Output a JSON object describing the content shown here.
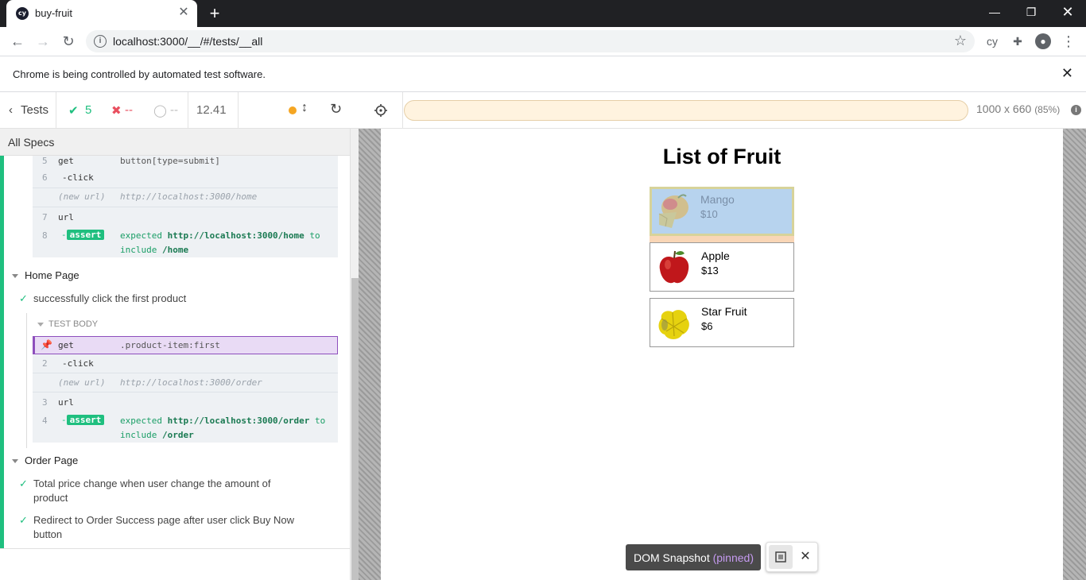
{
  "browser": {
    "tab_title": "buy-fruit",
    "favicon_text": "cy",
    "url": "localhost:3000/__/#/tests/__all",
    "infobar_message": "Chrome is being controlled by automated test software."
  },
  "reporter": {
    "tests_label": "Tests",
    "passed": "5",
    "failed": "--",
    "pending": "--",
    "duration": "12.41",
    "all_specs": "All Specs",
    "commands_top": [
      {
        "num": "5",
        "name": "get",
        "msg": "button[type=submit]"
      },
      {
        "num": "6",
        "name": "-click",
        "msg": ""
      },
      {
        "num": "",
        "name": "(new url)",
        "msg": "http://localhost:3000/home"
      },
      {
        "num": "7",
        "name": "url",
        "msg": ""
      },
      {
        "num": "8",
        "name": "-assert",
        "expected": "expected",
        "value": "http://localhost:3000/home",
        "to": "to",
        "include": "include",
        "target": "/home"
      }
    ],
    "suites": [
      {
        "title": "Home Page",
        "tests": [
          {
            "title": "successfully click the first product"
          }
        ],
        "test_body_label": "TEST BODY",
        "commands": [
          {
            "num": "",
            "name": "get",
            "msg": ".product-item:first"
          },
          {
            "num": "2",
            "name": "-click",
            "msg": ""
          },
          {
            "num": "",
            "name": "(new url)",
            "msg": "http://localhost:3000/order"
          },
          {
            "num": "3",
            "name": "url",
            "msg": ""
          },
          {
            "num": "4",
            "name": "-assert",
            "expected": "expected",
            "value": "http://localhost:3000/order",
            "to": "to",
            "include": "include",
            "target": "/order"
          }
        ]
      },
      {
        "title": "Order Page",
        "tests": [
          {
            "title_line1": "Total price change when user change the amount of",
            "title_line2": "product"
          },
          {
            "title_line1": "Redirect to Order Success page after user click Buy Now",
            "title_line2": "button"
          }
        ]
      }
    ]
  },
  "aut": {
    "viewport": "1000 x 660",
    "scale": "(85%)",
    "page_title": "List of Fruit",
    "products": [
      {
        "name": "Mango",
        "price": "$10"
      },
      {
        "name": "Apple",
        "price": "$13"
      },
      {
        "name": "Star Fruit",
        "price": "$6"
      }
    ],
    "snapshot_label": "DOM Snapshot",
    "snapshot_pinned": "(pinned)"
  },
  "colors": {
    "pass": "#1fbf7f",
    "fail": "#e94f5f",
    "highlight": "#e9dbf5",
    "highlight_border": "#8e4fbd",
    "mango_overlay": "#b7d3ee"
  }
}
